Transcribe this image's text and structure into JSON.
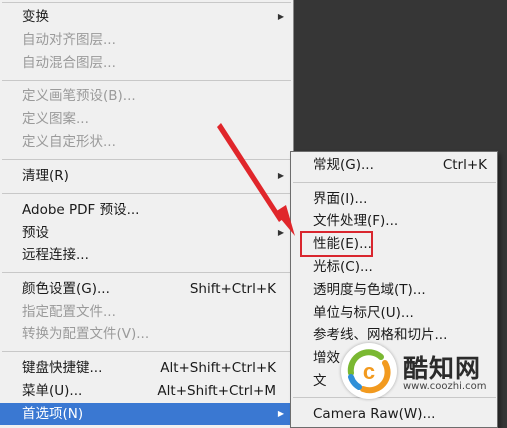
{
  "main_menu": {
    "items": [
      {
        "label": "变换",
        "shortcut": "",
        "has_submenu": true,
        "disabled": false
      },
      {
        "label": "自动对齐图层...",
        "shortcut": "",
        "has_submenu": false,
        "disabled": true
      },
      {
        "label": "自动混合图层...",
        "shortcut": "",
        "has_submenu": false,
        "disabled": true
      },
      {
        "label": "定义画笔预设(B)...",
        "shortcut": "",
        "has_submenu": false,
        "disabled": true
      },
      {
        "label": "定义图案...",
        "shortcut": "",
        "has_submenu": false,
        "disabled": true
      },
      {
        "label": "定义自定形状...",
        "shortcut": "",
        "has_submenu": false,
        "disabled": true
      },
      {
        "label": "清理(R)",
        "shortcut": "",
        "has_submenu": true,
        "disabled": false
      },
      {
        "label": "Adobe PDF 预设...",
        "shortcut": "",
        "has_submenu": false,
        "disabled": false
      },
      {
        "label": "预设",
        "shortcut": "",
        "has_submenu": true,
        "disabled": false
      },
      {
        "label": "远程连接...",
        "shortcut": "",
        "has_submenu": false,
        "disabled": false
      },
      {
        "label": "颜色设置(G)...",
        "shortcut": "Shift+Ctrl+K",
        "has_submenu": false,
        "disabled": false
      },
      {
        "label": "指定配置文件...",
        "shortcut": "",
        "has_submenu": false,
        "disabled": true
      },
      {
        "label": "转换为配置文件(V)...",
        "shortcut": "",
        "has_submenu": false,
        "disabled": true
      },
      {
        "label": "键盘快捷键...",
        "shortcut": "Alt+Shift+Ctrl+K",
        "has_submenu": false,
        "disabled": false
      },
      {
        "label": "菜单(U)...",
        "shortcut": "Alt+Shift+Ctrl+M",
        "has_submenu": false,
        "disabled": false
      },
      {
        "label": "首选项(N)",
        "shortcut": "",
        "has_submenu": true,
        "disabled": false,
        "selected": true
      }
    ]
  },
  "submenu": {
    "items": [
      {
        "label": "常规(G)...",
        "shortcut": "Ctrl+K"
      },
      {
        "label": "界面(I)...",
        "shortcut": ""
      },
      {
        "label": "文件处理(F)...",
        "shortcut": ""
      },
      {
        "label": "性能(E)...",
        "shortcut": "",
        "highlighted": true
      },
      {
        "label": "光标(C)...",
        "shortcut": ""
      },
      {
        "label": "透明度与色域(T)...",
        "shortcut": ""
      },
      {
        "label": "单位与标尺(U)...",
        "shortcut": ""
      },
      {
        "label": "参考线、网格和切片...",
        "shortcut": ""
      },
      {
        "label": "增效",
        "shortcut": ""
      },
      {
        "label": "文",
        "shortcut": ""
      },
      {
        "label": "Camera Raw(W)...",
        "shortcut": ""
      }
    ]
  },
  "watermark": {
    "title": "酷知网",
    "url": "www.coozhi.com",
    "logo_letter": "c"
  },
  "colors": {
    "menu_bg": "#f0f0f0",
    "selection": "#3a78d2",
    "highlight_box": "#d9262e",
    "annotation_arrow": "#e0262b",
    "workspace": "#363636",
    "disabled_text": "#9a9a9a"
  },
  "icons": {
    "submenu_arrow": "▶"
  }
}
